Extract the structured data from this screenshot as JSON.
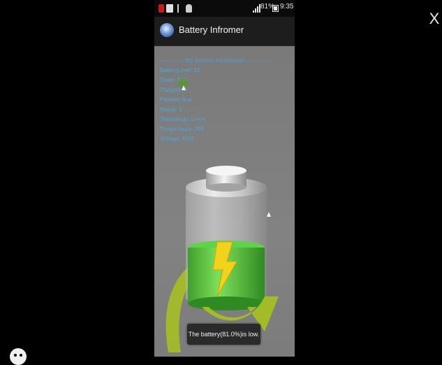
{
  "overlay": {
    "close_label": "X"
  },
  "statusbar": {
    "icons": [
      "notification-icon",
      "message-icon",
      "usb-icon",
      "android-debug-icon"
    ],
    "signal_icon": "signal-icon",
    "battery_percent": "81%",
    "battery_icon": "battery-icon",
    "time": "9:35"
  },
  "app": {
    "title": "Battery Infromer",
    "logo_icon": "app-logo-icon"
  },
  "info": {
    "header": "------------ My Battery Information ------------",
    "rows": [
      "BatteryLevel: 81",
      "Scale: 100",
      "Plugged: 0",
      "Present: true",
      "Status: 3",
      "Technology: Li-ion",
      "Temperature: 285",
      "Voltage: 4042"
    ]
  },
  "toast": {
    "message": "The battery(81.0%)is low."
  },
  "colors": {
    "info_text": "#4aa6e0",
    "app_background": "#7b7b7b",
    "toast_background": "#2a2a2a",
    "battery_fill": "#4fbf3a",
    "bolt": "#f2d21a"
  }
}
